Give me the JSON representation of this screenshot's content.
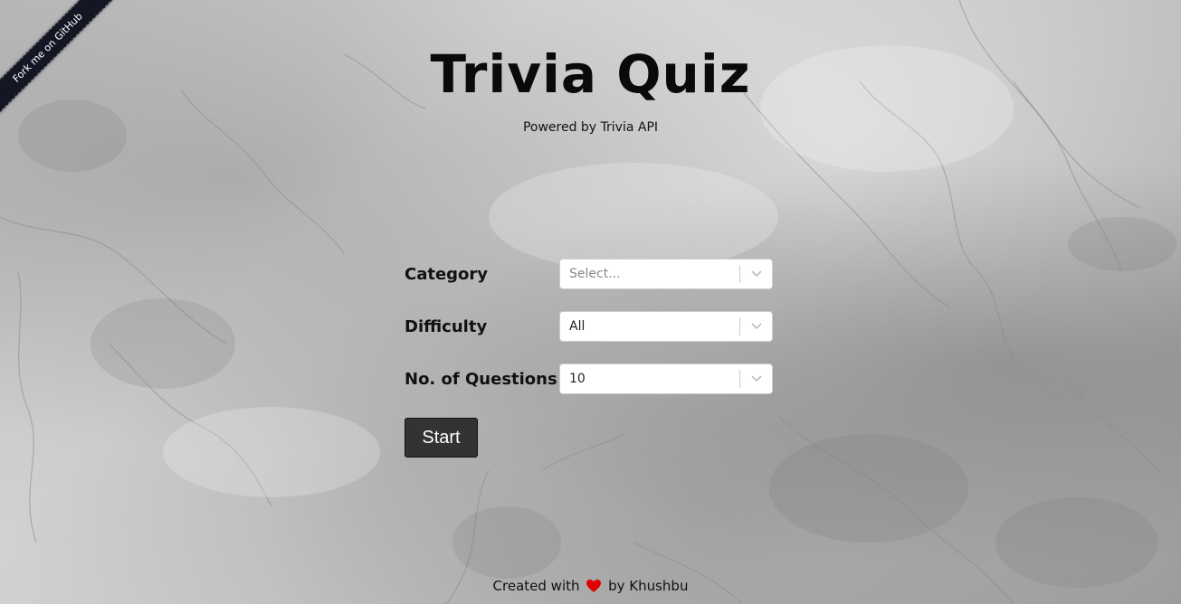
{
  "ribbon": {
    "label": "Fork me on GitHub"
  },
  "header": {
    "title": "Trivia Quiz",
    "subtitle": "Powered by Trivia API"
  },
  "form": {
    "category": {
      "label": "Category",
      "placeholder": "Select..."
    },
    "difficulty": {
      "label": "Difficulty",
      "value": "All"
    },
    "questions": {
      "label": "No. of Questions",
      "value": "10"
    },
    "start_label": "Start"
  },
  "footer": {
    "prefix": "Created with",
    "suffix": "by Khushbu",
    "heart_icon": "heart-icon",
    "heart_color": "#e00000"
  },
  "colors": {
    "button_bg": "#333333",
    "ribbon_bg": "#151624"
  }
}
